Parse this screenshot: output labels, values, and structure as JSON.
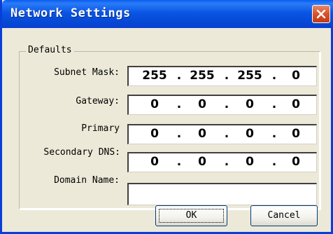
{
  "window": {
    "title": "Network Settings",
    "close_icon": "close-icon"
  },
  "group": {
    "legend": "Defaults"
  },
  "fields": {
    "subnet_mask": {
      "label": "Subnet Mask:",
      "octets": [
        "255",
        "255",
        "255",
        "0"
      ]
    },
    "gateway": {
      "label": "Gateway:",
      "octets": [
        "0",
        "0",
        "0",
        "0"
      ]
    },
    "primary": {
      "label": "Primary",
      "octets": [
        "0",
        "0",
        "0",
        "0"
      ]
    },
    "secondary_dns": {
      "label": "Secondary DNS:",
      "octets": [
        "0",
        "0",
        "0",
        "0"
      ]
    },
    "domain_name": {
      "label": "Domain Name:",
      "value": ""
    }
  },
  "ip_separator": ".",
  "buttons": {
    "ok": "OK",
    "cancel": "Cancel"
  },
  "colors": {
    "titlebar": "#0a56e4",
    "close_button": "#d8522a",
    "dialog_background": "#ece9d8"
  }
}
